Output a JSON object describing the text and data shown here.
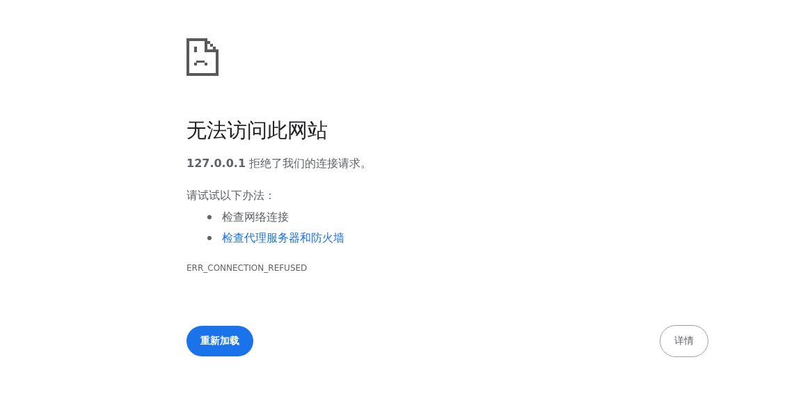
{
  "heading": "无法访问此网站",
  "summary": "**127.0.0.1** 拒绝了我们的连接请求。",
  "suggestions_intro": "请试试以下办法：",
  "suggestions": [
    {
      "kind": "text",
      "label": "检查网络连接"
    },
    {
      "kind": "link",
      "label": "检查代理服务器和防火墙"
    }
  ],
  "error_code": "ERR_CONNECTION_REFUSED",
  "buttons": [
    {
      "kind": "primary",
      "label": "重新加载"
    },
    {
      "kind": "secondary",
      "label": "详情"
    }
  ]
}
